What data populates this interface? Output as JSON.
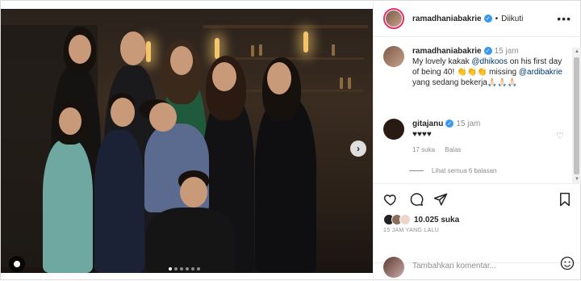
{
  "post": {
    "photo_alt": "",
    "carousel": {
      "total": 6,
      "active": 0
    },
    "next_icon": "chevron-right-icon",
    "user_tag_icon": "person-icon"
  },
  "header": {
    "username": "ramadhaniabakrie",
    "separator": "•",
    "follow_state": "Diikuti",
    "more": "•••"
  },
  "caption": {
    "username": "ramadhaniabakrie",
    "time": "15 jam",
    "text_before": "My lovely kakak ",
    "mention1": "@dhikoos",
    "text_mid": " on his first day of being 40! 👏👏👏 missing ",
    "mention2": "@ardibakrie",
    "text_after": " yang sedang bekerja🙏🏻🙏🏻🙏🏻"
  },
  "comment": {
    "username": "gitajanu",
    "time": "15 jam",
    "text": "♥♥♥♥",
    "likes": "17 suka",
    "reply": "Balas",
    "view_replies": "Lihat semua 6 balasan"
  },
  "stats": {
    "likes": "10.025 suka",
    "time_ago": "15 JAM YANG LALU"
  },
  "add_comment": {
    "placeholder": "Tambahkan komentar..."
  },
  "colors": {
    "verified": "#3897f0",
    "mention": "#00376b",
    "story_ring": "#e1306c"
  }
}
